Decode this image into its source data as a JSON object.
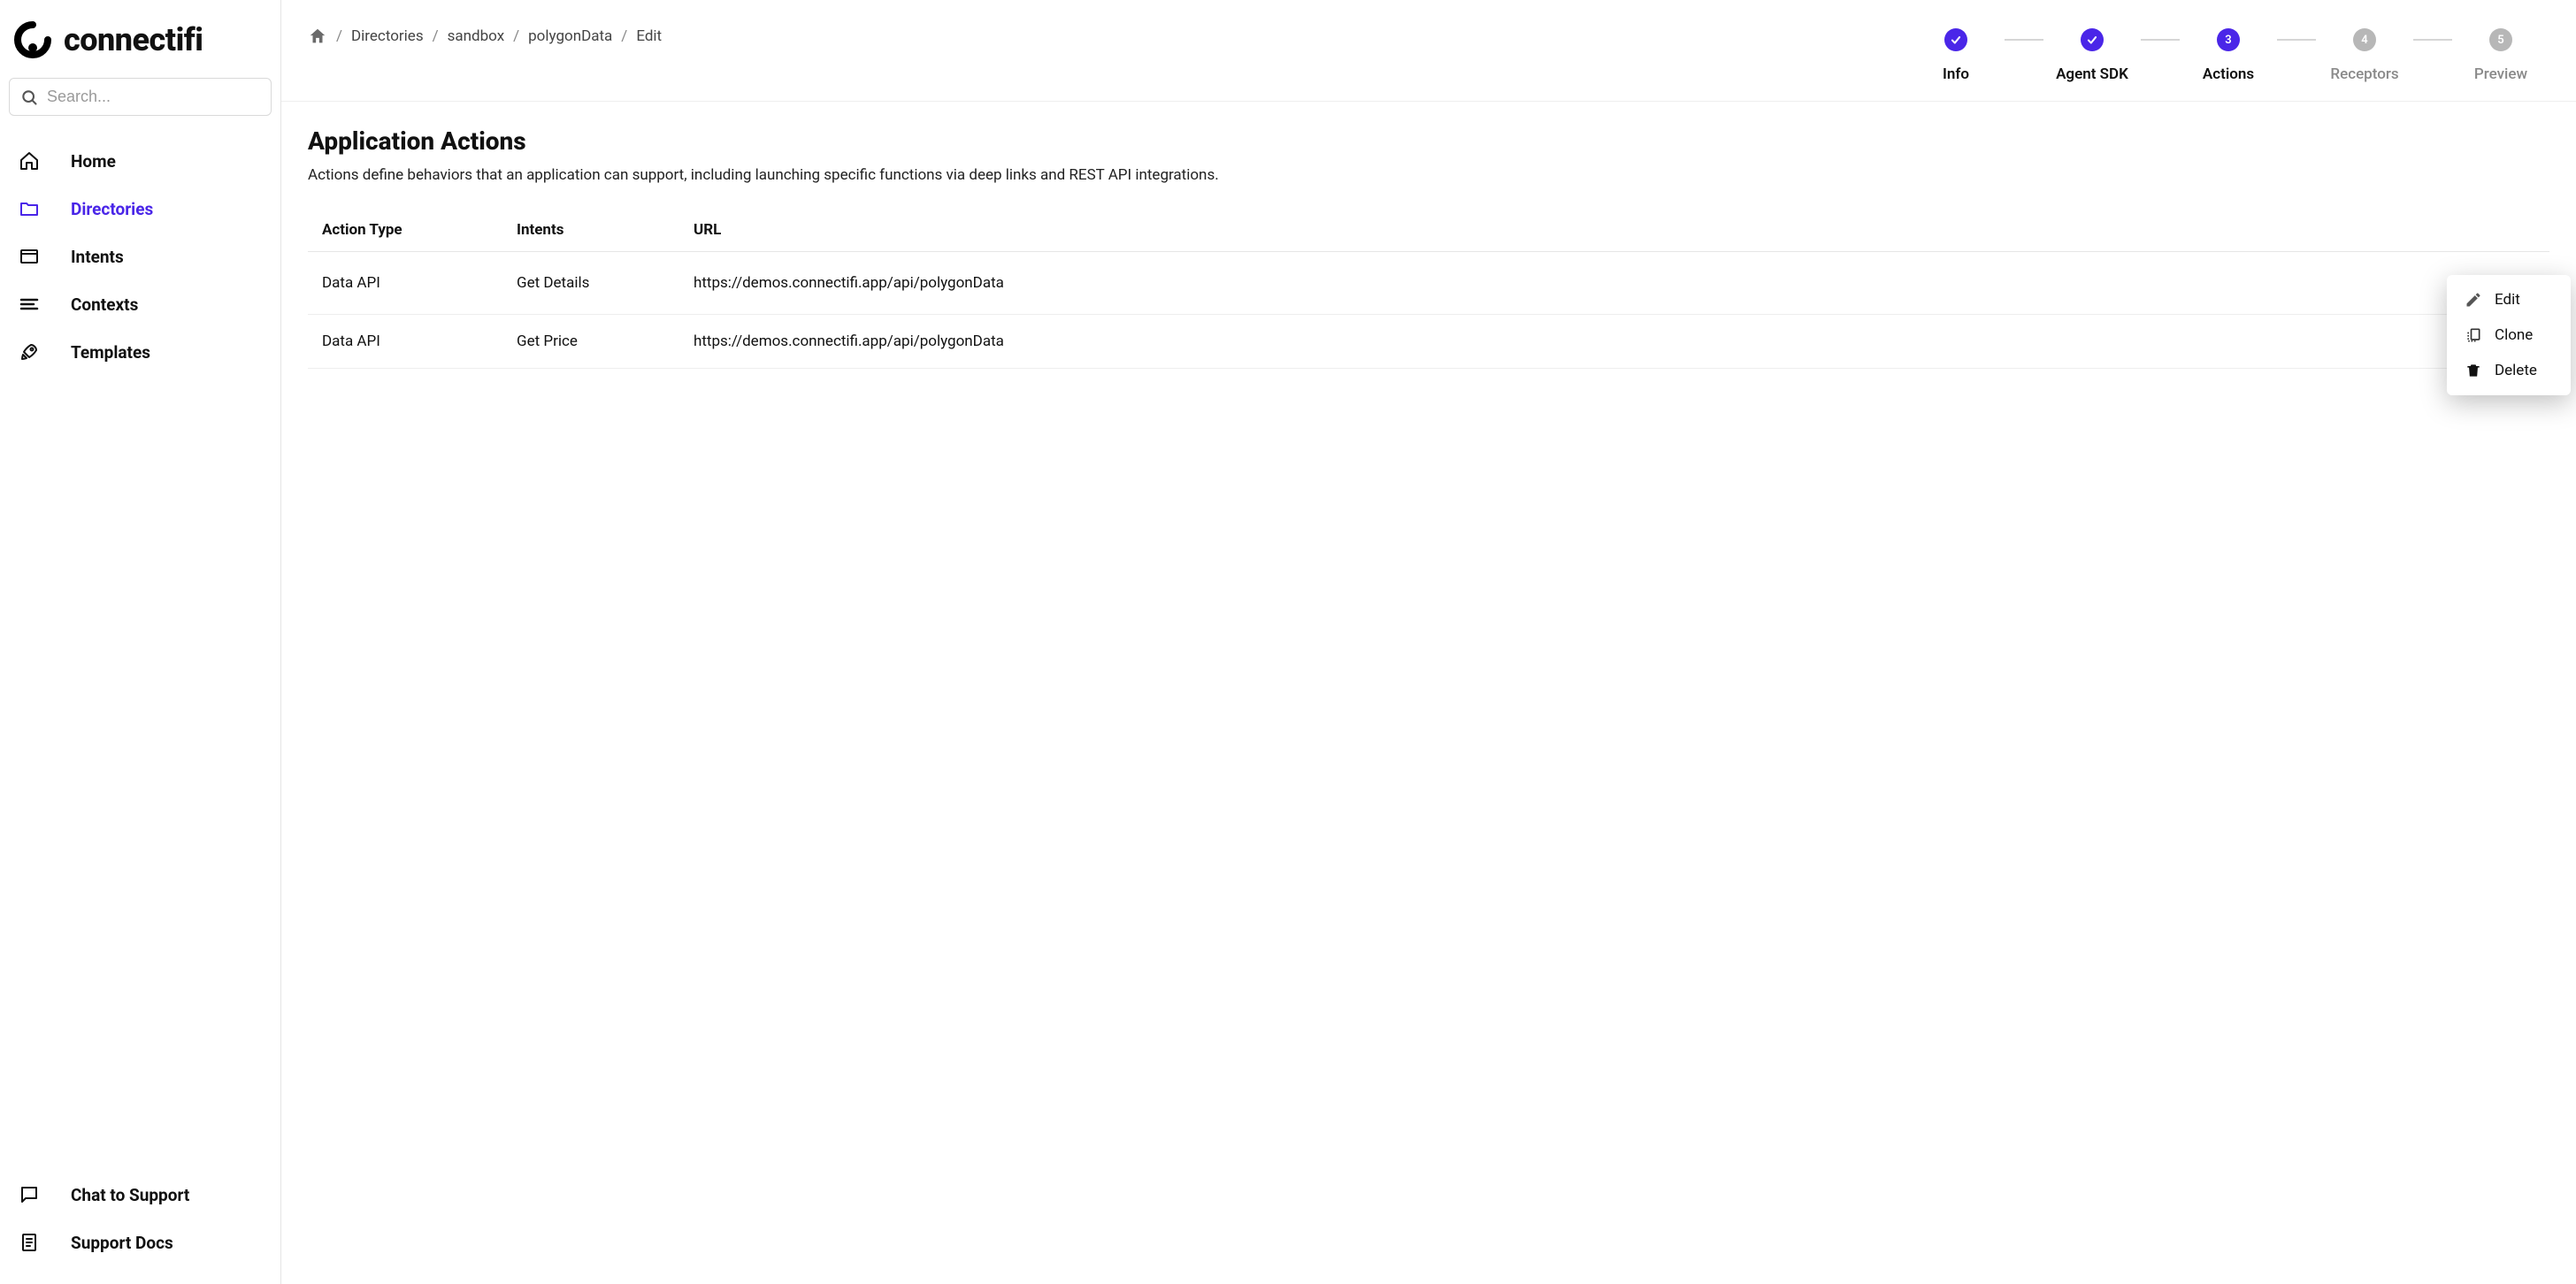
{
  "brand": {
    "name": "connectifi"
  },
  "search": {
    "placeholder": "Search..."
  },
  "sidebar": {
    "items": [
      {
        "icon": "home-icon",
        "label": "Home",
        "active": false
      },
      {
        "icon": "folder-icon",
        "label": "Directories",
        "active": true
      },
      {
        "icon": "window-icon",
        "label": "Intents",
        "active": false
      },
      {
        "icon": "list-icon",
        "label": "Contexts",
        "active": false
      },
      {
        "icon": "rocket-icon",
        "label": "Templates",
        "active": false
      }
    ],
    "bottom": [
      {
        "icon": "chat-icon",
        "label": "Chat to Support"
      },
      {
        "icon": "doc-icon",
        "label": "Support Docs"
      }
    ]
  },
  "breadcrumbs": {
    "items": [
      "Directories",
      "sandbox",
      "polygonData",
      "Edit"
    ]
  },
  "stepper": {
    "steps": [
      {
        "label": "Info",
        "state": "done"
      },
      {
        "label": "Agent SDK",
        "state": "done"
      },
      {
        "label": "Actions",
        "state": "current",
        "num": "3"
      },
      {
        "label": "Receptors",
        "state": "pending",
        "num": "4"
      },
      {
        "label": "Preview",
        "state": "pending",
        "num": "5"
      }
    ]
  },
  "page": {
    "title": "Application Actions",
    "description": "Actions define behaviors that an application can support, including launching specific functions via deep links and REST API integrations."
  },
  "table": {
    "headers": {
      "action_type": "Action Type",
      "intents": "Intents",
      "url": "URL"
    },
    "rows": [
      {
        "action_type": "Data API",
        "intents": "Get Details",
        "url": "https://demos.connectifi.app/api/polygonData"
      },
      {
        "action_type": "Data API",
        "intents": "Get Price",
        "url": "https://demos.connectifi.app/api/polygonData"
      }
    ]
  },
  "context_menu": {
    "items": [
      {
        "icon": "edit-icon",
        "label": "Edit"
      },
      {
        "icon": "clone-icon",
        "label": "Clone"
      },
      {
        "icon": "delete-icon",
        "label": "Delete"
      }
    ]
  }
}
